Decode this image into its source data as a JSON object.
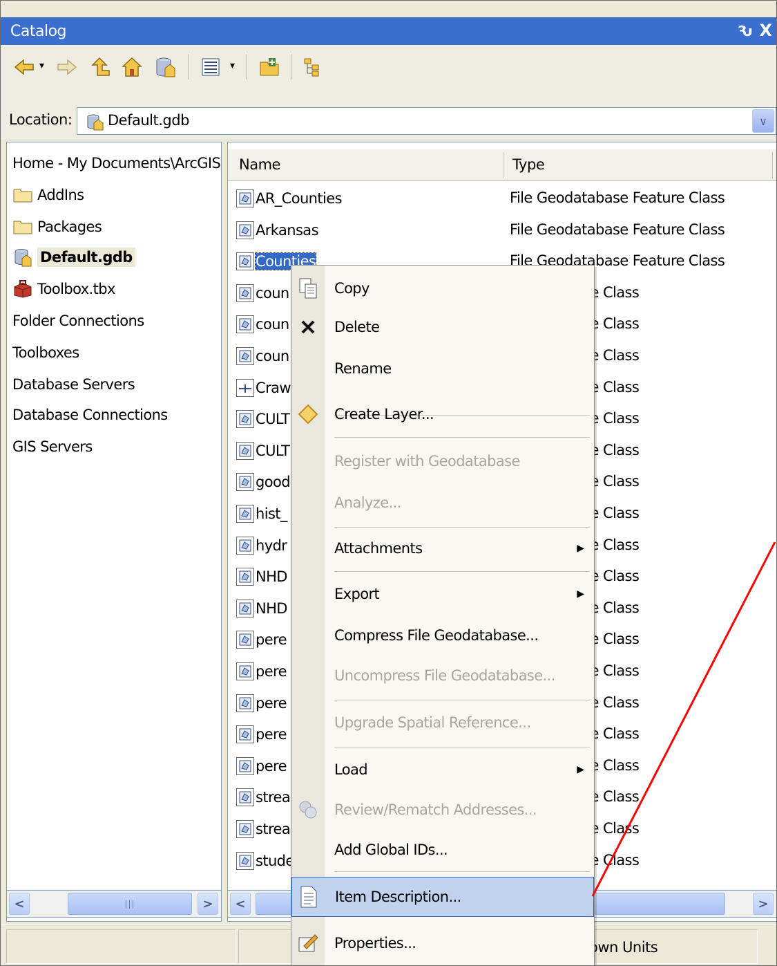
{
  "window": {
    "title": "Catalog",
    "pin_glyph": "Ԅ",
    "close_glyph": "X"
  },
  "toolbar": {
    "buttons": [
      "back-icon",
      "forward-icon",
      "up-one-level-icon",
      "home-folder-icon",
      "default-geodatabase-icon",
      "views-icon",
      "connect-to-folder-icon",
      "toggle-contents-panel-icon"
    ],
    "dropdown_glyph": "▾"
  },
  "location": {
    "label": "Location:",
    "value": "Default.gdb",
    "dropdown_glyph": "∨"
  },
  "tree": {
    "items": [
      {
        "label": "Home - My Documents\\ArcGIS",
        "icon": "none"
      },
      {
        "label": "AddIns",
        "icon": "folder-icon"
      },
      {
        "label": "Packages",
        "icon": "folder-icon"
      },
      {
        "label": "Default.gdb",
        "icon": "geodatabase-icon",
        "selected": true
      },
      {
        "label": "Toolbox.tbx",
        "icon": "toolbox-icon"
      },
      {
        "label": "Folder Connections",
        "icon": "none"
      },
      {
        "label": "Toolboxes",
        "icon": "none"
      },
      {
        "label": "Database Servers",
        "icon": "none"
      },
      {
        "label": "Database Connections",
        "icon": "none"
      },
      {
        "label": "GIS Servers",
        "icon": "none"
      }
    ]
  },
  "list": {
    "columns": [
      "Name",
      "Type"
    ],
    "rows": [
      {
        "name": "AR_Counties",
        "type": "File Geodatabase Feature Class"
      },
      {
        "name": "Arkansas",
        "type": "File Geodatabase Feature Class"
      },
      {
        "name": "Counties",
        "type": "File Geodatabase Feature Class",
        "selected": true
      },
      {
        "name": "coun",
        "type": "base Feature Class"
      },
      {
        "name": "coun",
        "type": "base Feature Class"
      },
      {
        "name": "coun",
        "type": "base Feature Class"
      },
      {
        "name": "Craw",
        "type": "base Feature Class",
        "icon": "line"
      },
      {
        "name": "CULT",
        "type": "base Feature Class"
      },
      {
        "name": "CULT",
        "type": "base Feature Class"
      },
      {
        "name": "good",
        "type": "base Feature Class"
      },
      {
        "name": "hist_",
        "type": "base Feature Class"
      },
      {
        "name": "hydr",
        "type": "base Feature Class"
      },
      {
        "name": "NHD",
        "type": "base Feature Class"
      },
      {
        "name": "NHD",
        "type": "base Feature Class"
      },
      {
        "name": "pere",
        "type": "base Feature Class"
      },
      {
        "name": "pere",
        "type": "base Feature Class"
      },
      {
        "name": "pere",
        "type": "base Feature Class"
      },
      {
        "name": "pere",
        "type": "base Feature Class"
      },
      {
        "name": "pere",
        "type": "base Feature Class"
      },
      {
        "name": "strea",
        "type": "base Feature Class"
      },
      {
        "name": "strea",
        "type": "base Feature Class"
      },
      {
        "name": "stude",
        "type": "base Feature Class"
      }
    ]
  },
  "context_menu": {
    "items": [
      {
        "label": "Copy",
        "icon": "copy-icon",
        "enabled": true
      },
      {
        "label": "Delete",
        "icon": "delete-icon",
        "enabled": true
      },
      {
        "label": "Rename",
        "icon": "none",
        "enabled": true
      },
      {
        "label": "Create Layer...",
        "icon": "layer-icon",
        "enabled": true
      },
      {
        "label": "Register with Geodatabase",
        "icon": "none",
        "enabled": false
      },
      {
        "label": "Analyze...",
        "icon": "none",
        "enabled": false
      },
      {
        "label": "Attachments",
        "icon": "none",
        "enabled": true,
        "submenu": true
      },
      {
        "label": "Export",
        "icon": "none",
        "enabled": true,
        "submenu": true
      },
      {
        "label": "Compress File Geodatabase...",
        "icon": "none",
        "enabled": true
      },
      {
        "label": "Uncompress File Geodatabase...",
        "icon": "none",
        "enabled": false
      },
      {
        "label": "Upgrade Spatial Reference...",
        "icon": "none",
        "enabled": false
      },
      {
        "label": "Load",
        "icon": "none",
        "enabled": true,
        "submenu": true
      },
      {
        "label": "Review/Rematch Addresses...",
        "icon": "review-addresses-icon",
        "enabled": false
      },
      {
        "label": "Add Global IDs...",
        "icon": "none",
        "enabled": true
      },
      {
        "label": "Item Description...",
        "icon": "item-description-icon",
        "enabled": true,
        "highlighted": true
      },
      {
        "label": "Properties...",
        "icon": "properties-icon",
        "enabled": true
      }
    ],
    "submenu_glyph": "▶"
  },
  "scrollbars": {
    "left_glyph": "<",
    "right_glyph": ">",
    "thumb_grip": "|||"
  },
  "status": {
    "units": "own Units"
  },
  "annotation": {
    "color": "#ff0000"
  },
  "colors": {
    "title_bar": "#3a6fd0",
    "selection": "#316ac5",
    "menu_highlight": "#c1d2ee"
  }
}
